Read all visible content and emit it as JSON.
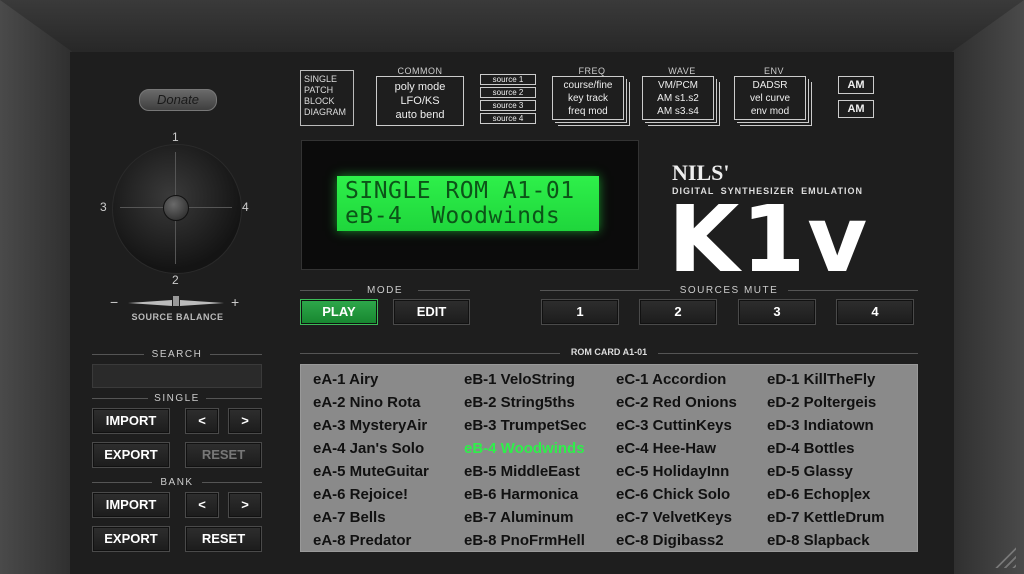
{
  "donate_label": "Donate",
  "diagram": {
    "single_patch_block_diagram": [
      "SINGLE",
      "PATCH",
      "BLOCK",
      "DIAGRAM"
    ],
    "common_label": "COMMON",
    "common_items": [
      "poly mode",
      "LFO/KS",
      "auto bend"
    ],
    "sources": [
      "source 1",
      "source 2",
      "source 3",
      "source 4"
    ],
    "freq_label": "FREQ",
    "freq_items": [
      "course/fine",
      "key track",
      "freq mod"
    ],
    "wave_label": "WAVE",
    "wave_items": [
      "VM/PCM",
      "AM s1.s2",
      "AM s3.s4"
    ],
    "env_label": "ENV",
    "env_items": [
      "DADSR",
      "vel curve",
      "env mod"
    ],
    "am_labels": [
      "AM",
      "AM"
    ]
  },
  "lcd": {
    "line1": "SINGLE ROM A1-01",
    "line2": "eB-4  Woodwinds"
  },
  "brand": {
    "nils": "NILS'",
    "subtitle": "DIGITAL SYNTHESIZER EMULATION",
    "logo": "K1v"
  },
  "joystick": {
    "labels": [
      "1",
      "2",
      "3",
      "4"
    ],
    "minus": "−",
    "plus": "+",
    "balance_label": "SOURCE BALANCE"
  },
  "mode": {
    "label": "MODE",
    "play": "PLAY",
    "edit": "EDIT",
    "active": "PLAY",
    "active_color": "#22a33f"
  },
  "sources_mute": {
    "label": "SOURCES MUTE",
    "buttons": [
      "1",
      "2",
      "3",
      "4"
    ]
  },
  "search": {
    "label": "SEARCH",
    "value": ""
  },
  "single": {
    "label": "SINGLE",
    "import": "IMPORT",
    "export": "EXPORT",
    "prev": "<",
    "next": ">",
    "reset": "RESET"
  },
  "bank": {
    "label": "BANK",
    "import": "IMPORT",
    "export": "EXPORT",
    "prev": "<",
    "next": ">",
    "reset": "RESET"
  },
  "rom_card": {
    "title": "ROM CARD A1-01",
    "active_color": "#2ef04a",
    "columns": [
      [
        "eA-1 Airy",
        "eA-2 Nino Rota",
        "eA-3 MysteryAir",
        "eA-4 Jan's Solo",
        "eA-5 MuteGuitar",
        "eA-6 Rejoice!",
        "eA-7 Bells",
        "eA-8 Predator"
      ],
      [
        "eB-1 VeloString",
        "eB-2 String5ths",
        "eB-3 TrumpetSec",
        "eB-4 Woodwinds",
        "eB-5 MiddleEast",
        "eB-6 Harmonica",
        "eB-7 Aluminum",
        "eB-8 PnoFrmHell"
      ],
      [
        "eC-1 Accordion",
        "eC-2 Red Onions",
        "eC-3 CuttinKeys",
        "eC-4 Hee-Haw",
        "eC-5 HolidayInn",
        "eC-6 Chick Solo",
        "eC-7 VelvetKeys",
        "eC-8 Digibass2"
      ],
      [
        "eD-1 KillTheFly",
        "eD-2 Poltergeis",
        "eD-3 Indiatown",
        "eD-4 Bottles",
        "eD-5 Glassy",
        "eD-6 Echop|ex",
        "eD-7 KettleDrum",
        "eD-8 Slapback"
      ]
    ],
    "selected": "eB-4 Woodwinds"
  }
}
